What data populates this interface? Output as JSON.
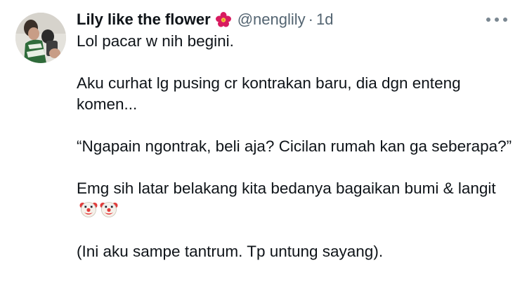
{
  "author": {
    "display_name": "Lily like the flower",
    "name_emoji": "flower-emoji",
    "handle": "@nenglily",
    "separator": "·",
    "time": "1d",
    "avatar": "avatar-photo"
  },
  "tweet": {
    "paragraphs": [
      "Lol pacar w nih begini.",
      "Aku curhat lg pusing cr kontrakan baru, dia dgn enteng komen...",
      "“Ngapain ngontrak, beli aja? Cicilan rumah kan ga seberapa?”",
      "Emg sih latar belakang kita bedanya bagaikan bumi & langit",
      "(Ini aku sampe tantrum. Tp untung sayang)."
    ],
    "paragraph_emojis": [
      "clown-face-emoji",
      "clown-face-emoji"
    ]
  },
  "menu": {
    "icon": "more-horizontal-icon"
  },
  "colors": {
    "text": "#0f1419",
    "secondary": "#536471",
    "flower": "#d81b60"
  }
}
